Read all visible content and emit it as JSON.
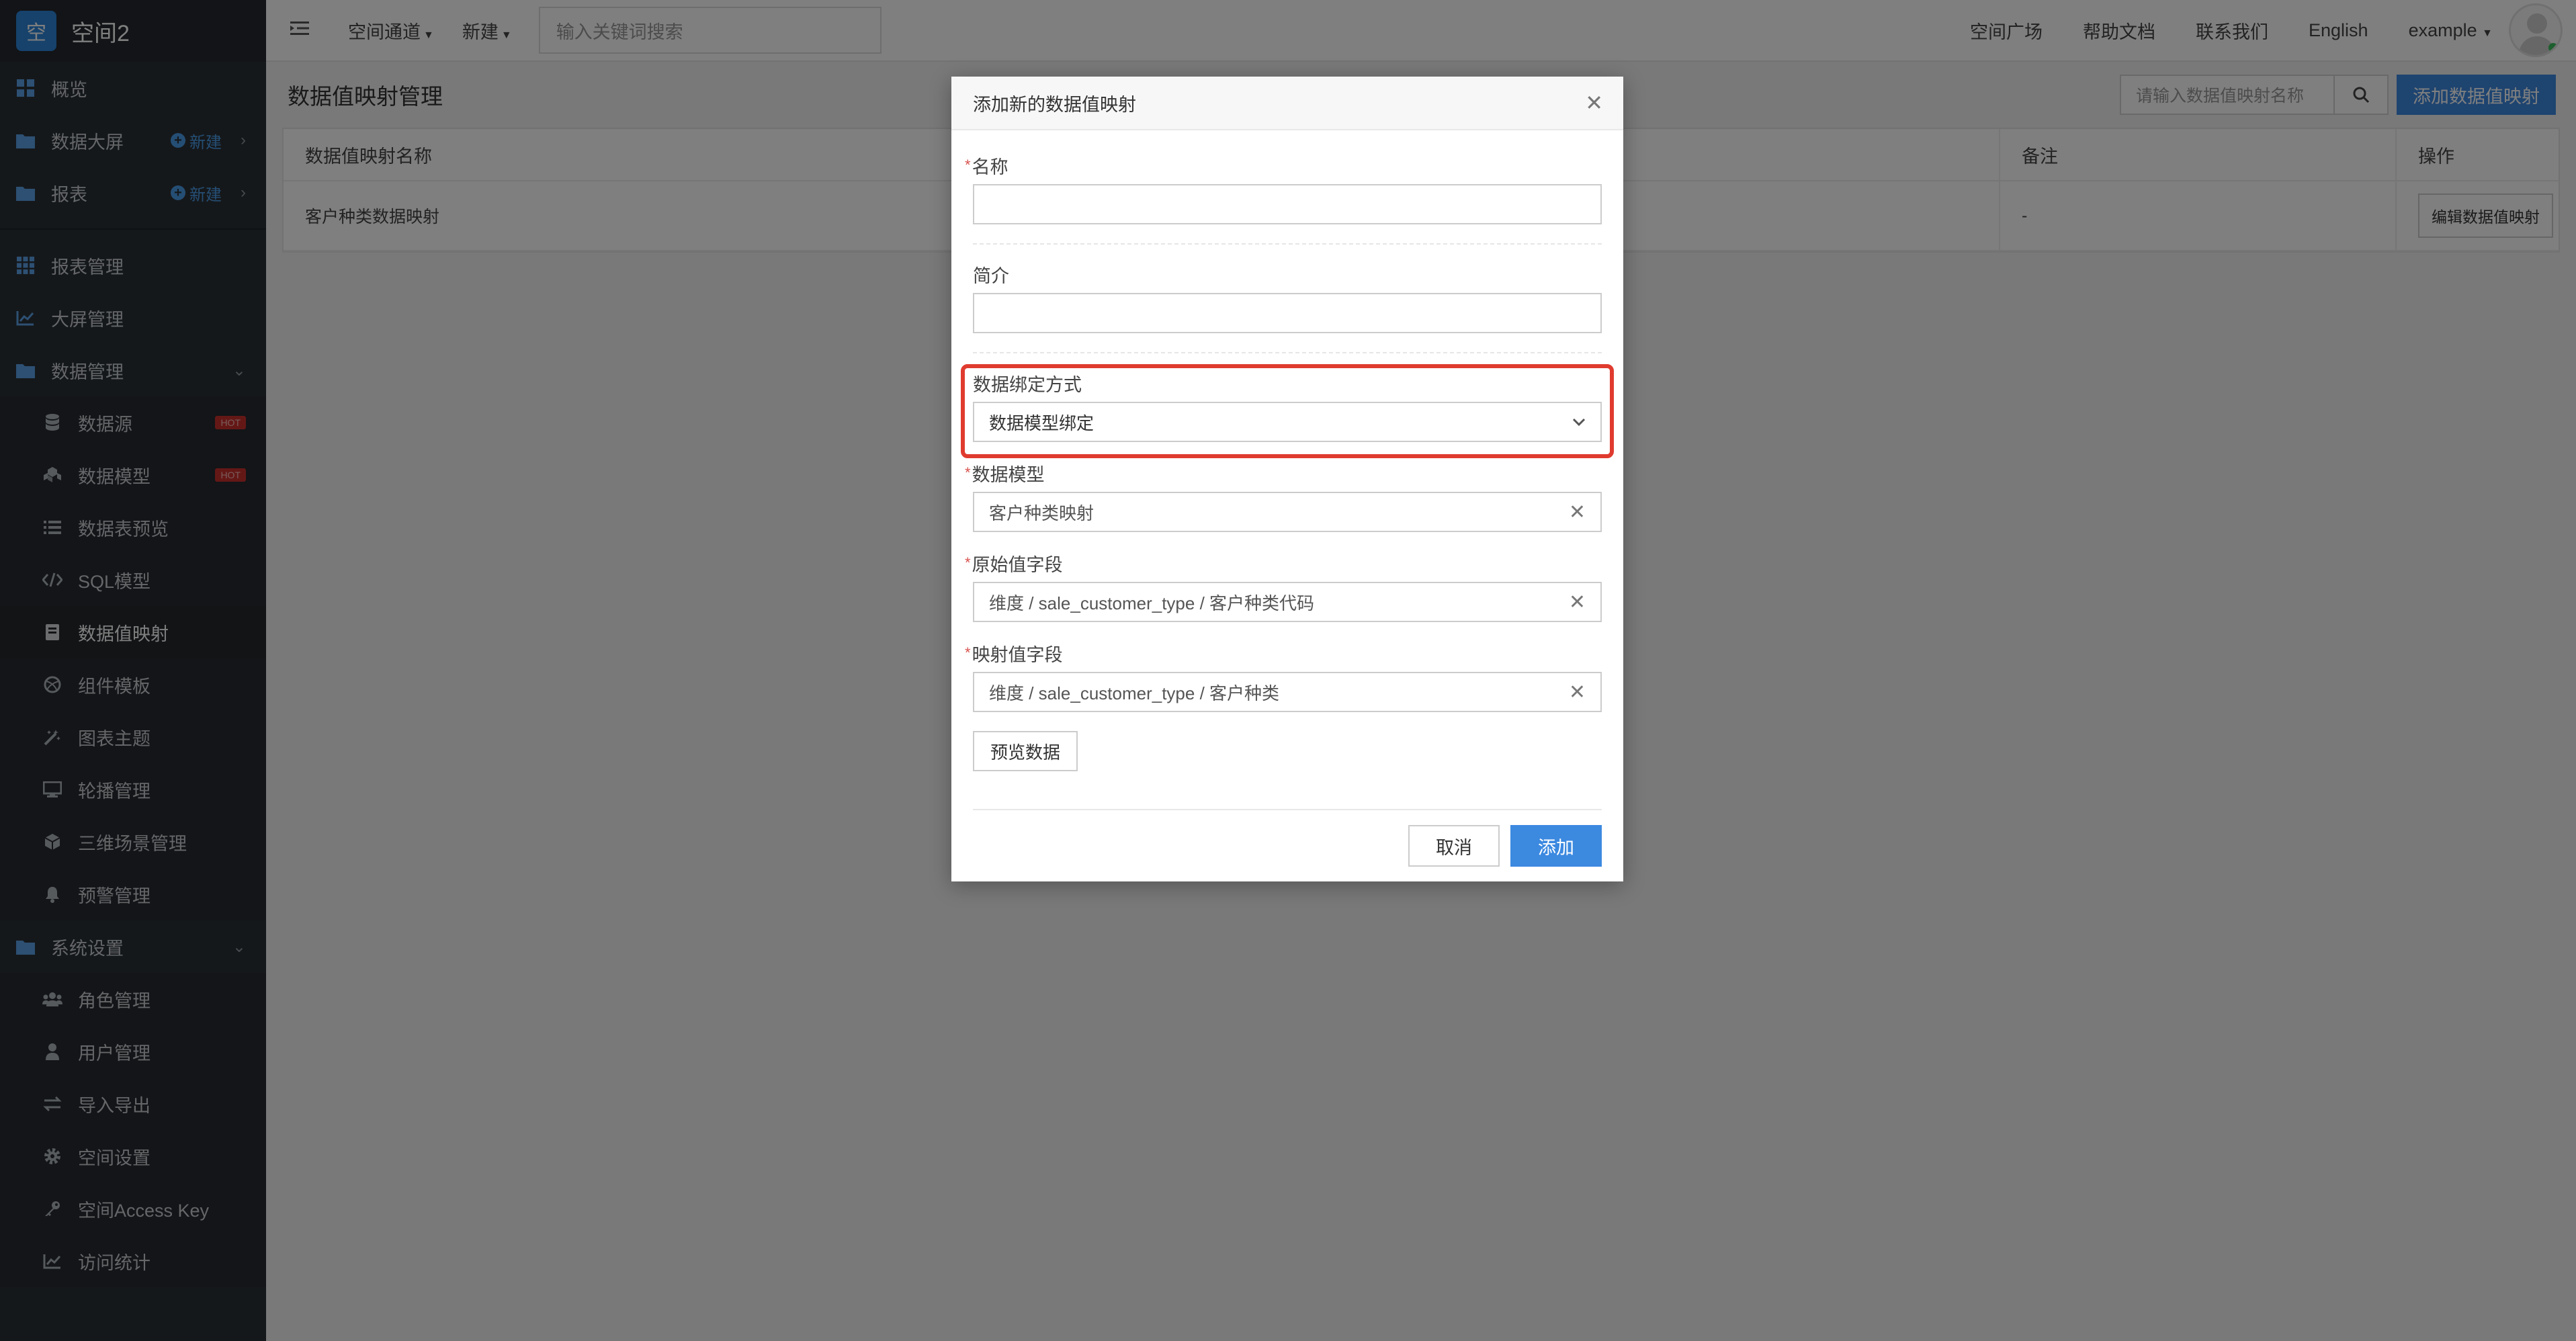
{
  "brand": {
    "logo_char": "空",
    "name": "空间2"
  },
  "sidebar": {
    "top_items": [
      {
        "label": "概览",
        "icon": "grid-icon"
      },
      {
        "label": "数据大屏",
        "icon": "folder-icon",
        "new_label": "新建"
      },
      {
        "label": "报表",
        "icon": "folder-icon",
        "new_label": "新建"
      }
    ],
    "mid_items": [
      {
        "label": "报表管理",
        "icon": "grid-icon"
      },
      {
        "label": "大屏管理",
        "icon": "chart-icon"
      },
      {
        "label": "数据管理",
        "icon": "folder-icon"
      }
    ],
    "data_sub": [
      {
        "label": "数据源",
        "icon": "database-icon",
        "badge": "HOT"
      },
      {
        "label": "数据模型",
        "icon": "cubes-icon",
        "badge": "HOT"
      },
      {
        "label": "数据表预览",
        "icon": "list-icon"
      },
      {
        "label": "SQL模型",
        "icon": "code-icon"
      },
      {
        "label": "数据值映射",
        "icon": "book-icon"
      },
      {
        "label": "组件模板",
        "icon": "dribbble-icon"
      },
      {
        "label": "图表主题",
        "icon": "magic-icon"
      },
      {
        "label": "轮播管理",
        "icon": "monitor-icon"
      },
      {
        "label": "三维场景管理",
        "icon": "cube-icon"
      },
      {
        "label": "预警管理",
        "icon": "bell-icon"
      }
    ],
    "system": {
      "label": "系统设置",
      "icon": "folder-icon"
    },
    "system_sub": [
      {
        "label": "角色管理",
        "icon": "users-icon"
      },
      {
        "label": "用户管理",
        "icon": "user-icon"
      },
      {
        "label": "导入导出",
        "icon": "exchange-icon"
      },
      {
        "label": "空间设置",
        "icon": "gear-icon"
      },
      {
        "label": "空间Access Key",
        "icon": "key-icon"
      },
      {
        "label": "访问统计",
        "icon": "chart-icon"
      }
    ]
  },
  "topbar": {
    "menu1": "空间通道",
    "menu2": "新建",
    "search_placeholder": "输入关键词搜索",
    "links": [
      "空间广场",
      "帮助文档",
      "联系我们",
      "English"
    ],
    "user": "example"
  },
  "page": {
    "title": "数据值映射管理",
    "search_placeholder": "请输入数据值映射名称",
    "add_button": "添加数据值映射",
    "table": {
      "headers": [
        "数据值映射名称",
        "备注",
        "操作"
      ],
      "rows": [
        {
          "name": "客户种类数据映射",
          "note": "-",
          "action": "编辑数据值映射"
        }
      ]
    }
  },
  "modal": {
    "title": "添加新的数据值映射",
    "name_label": "名称",
    "intro_label": "简介",
    "binding_label": "数据绑定方式",
    "binding_value": "数据模型绑定",
    "model_label": "数据模型",
    "model_value": "客户种类映射",
    "orig_label": "原始值字段",
    "orig_value": "维度 / sale_customer_type / 客户种类代码",
    "map_label": "映射值字段",
    "map_value": "维度 / sale_customer_type / 客户种类",
    "preview_button": "预览数据",
    "cancel_button": "取消",
    "add_button": "添加",
    "highlight_color": "#e03b2f"
  }
}
